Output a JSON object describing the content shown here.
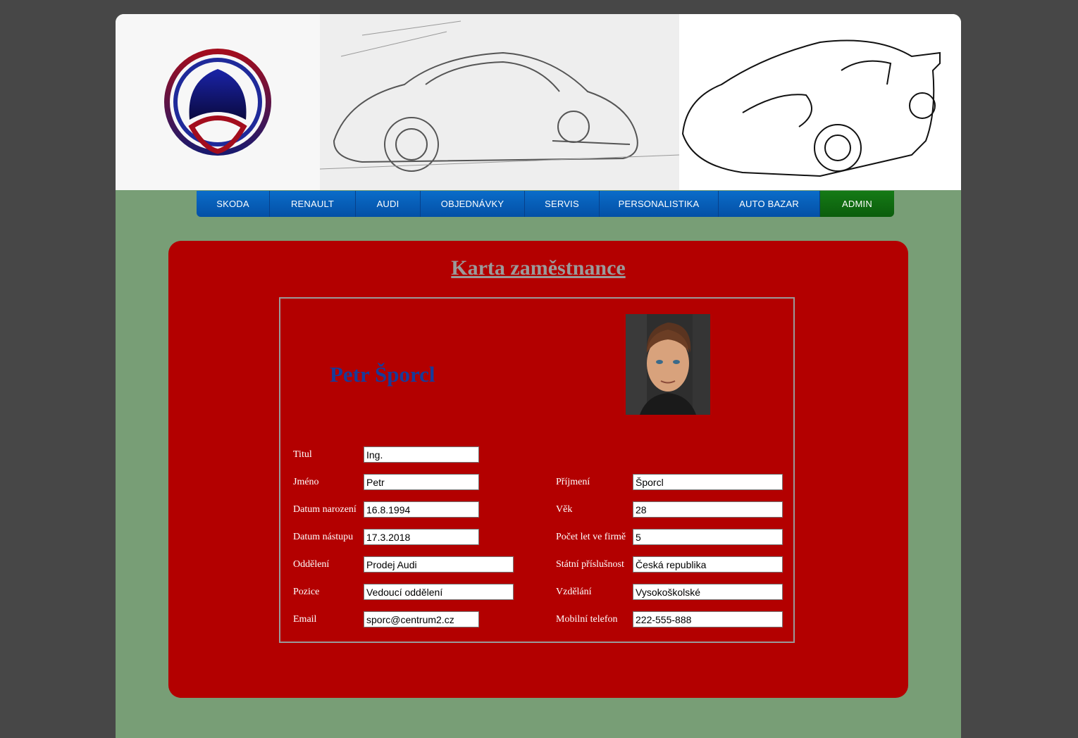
{
  "nav": {
    "items": [
      "SKODA",
      "RENAULT",
      "AUDI",
      "OBJEDNÁVKY",
      "SERVIS",
      "PERSONALISTIKA",
      "AUTO BAZAR",
      "ADMIN"
    ]
  },
  "card": {
    "title": "Karta zaměstnance",
    "employee_name": "Petr Šporcl"
  },
  "form": {
    "titul": {
      "label": "Titul",
      "value": "Ing."
    },
    "jmeno": {
      "label": "Jméno",
      "value": "Petr"
    },
    "datum_narozeni": {
      "label": "Datum narození",
      "value": "16.8.1994"
    },
    "datum_nastupu": {
      "label": "Datum nástupu",
      "value": "17.3.2018"
    },
    "oddeleni": {
      "label": "Oddělení",
      "value": "Prodej Audi"
    },
    "pozice": {
      "label": "Pozice",
      "value": "Vedoucí oddělení"
    },
    "email": {
      "label": "Email",
      "value": "sporc@centrum2.cz"
    },
    "prijmeni": {
      "label": "Příjmení",
      "value": "Šporcl"
    },
    "vek": {
      "label": "Věk",
      "value": "28"
    },
    "pocet_let": {
      "label": "Počet let ve firmě",
      "value": "5"
    },
    "statni_prislusnost": {
      "label": "Státní příslušnost",
      "value": "Česká republika"
    },
    "vzdelani": {
      "label": "Vzdělání",
      "value": "Vysokoškolské"
    },
    "mobilni_telefon": {
      "label": "Mobilní telefon",
      "value": "222-555-888"
    }
  },
  "colors": {
    "background": "#474747",
    "page": "#789e76",
    "card": "#b30000",
    "nav_blue": "#0a6cc9",
    "nav_admin": "#157a16",
    "name": "#173b9a",
    "title": "#9a9a9a"
  }
}
